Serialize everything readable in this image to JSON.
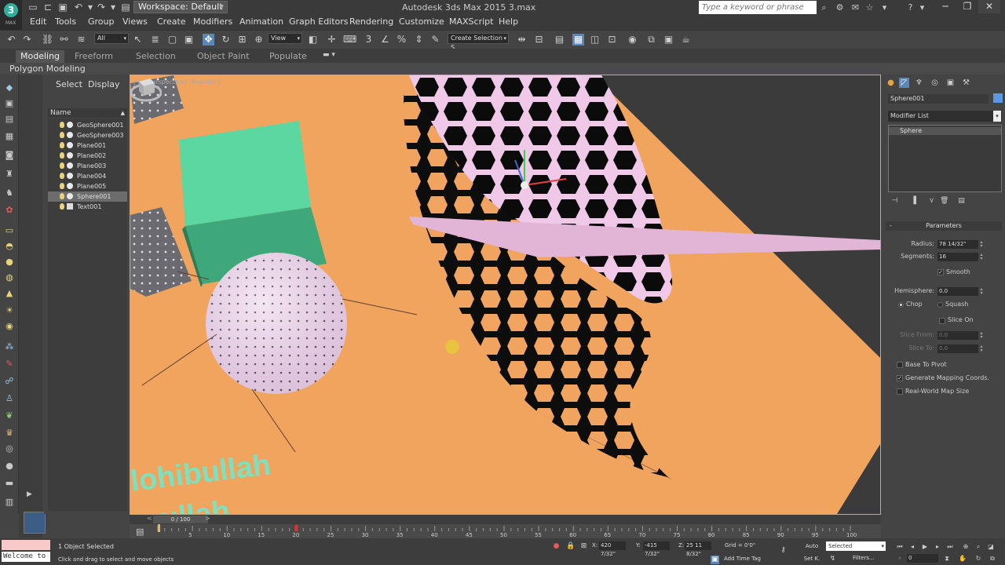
{
  "app": {
    "logo_letter": "3",
    "logo_sub": "MAX",
    "title": "Autodesk 3ds Max  2015      3.max",
    "workspace": "Workspace: Default",
    "search_placeholder": "Type a keyword or phrase"
  },
  "menu": [
    "Edit",
    "Tools",
    "Group",
    "Views",
    "Create",
    "Modifiers",
    "Animation",
    "Graph Editors",
    "Rendering",
    "Customize",
    "MAXScript",
    "Help"
  ],
  "toolbar": {
    "selection_filter": "All",
    "ref_coord": "View",
    "named_selection": "Create Selection S"
  },
  "ribbon": {
    "tabs": [
      "Modeling",
      "Freeform",
      "Selection",
      "Object Paint",
      "Populate"
    ],
    "active_tab": "Modeling",
    "panel_label": "Polygon Modeling"
  },
  "explorer": {
    "tabs": [
      "Select",
      "Display"
    ],
    "column_header": "Name",
    "items": [
      {
        "name": "GeoSphere001",
        "selected": false,
        "type": "geo"
      },
      {
        "name": "GeoSphere003",
        "selected": false,
        "type": "geo"
      },
      {
        "name": "Plane001",
        "selected": false,
        "type": "geo"
      },
      {
        "name": "Plane002",
        "selected": false,
        "type": "geo"
      },
      {
        "name": "Plane003",
        "selected": false,
        "type": "geo"
      },
      {
        "name": "Plane004",
        "selected": false,
        "type": "geo"
      },
      {
        "name": "Plane005",
        "selected": false,
        "type": "geo"
      },
      {
        "name": "Sphere001",
        "selected": true,
        "type": "geo"
      },
      {
        "name": "Text001",
        "selected": false,
        "type": "text"
      }
    ]
  },
  "viewport": {
    "label": "[+] [Perspective] [Realistic]",
    "text_line1": "lohibullah",
    "text_line2": "ullah"
  },
  "command_panel": {
    "object_name": "Sphere001",
    "object_color": "#5b98e4",
    "modifier_list": "Modifier List",
    "stack_item": "Sphere",
    "rollout_title": "Parameters",
    "radius_label": "Radius:",
    "radius_value": "78 14/32\"",
    "segments_label": "Segments:",
    "segments_value": "16",
    "smooth_label": "Smooth",
    "hemisphere_label": "Hemisphere:",
    "hemisphere_value": "0.0",
    "chop_label": "Chop",
    "squash_label": "Squash",
    "slice_on_label": "Slice On",
    "slice_from_label": "Slice From:",
    "slice_from_value": "0.0",
    "slice_to_label": "Slice To:",
    "slice_to_value": "0.0",
    "base_to_pivot_label": "Base To Pivot",
    "gen_mapping_label": "Generate Mapping Coords.",
    "real_world_label": "Real-World Map Size"
  },
  "timeline": {
    "slider": "0 / 100",
    "ticks": [
      "5",
      "10",
      "15",
      "20",
      "25",
      "30",
      "35",
      "40",
      "45",
      "50",
      "55",
      "60",
      "65",
      "70",
      "75",
      "80",
      "85",
      "90",
      "95",
      "100"
    ]
  },
  "status": {
    "maxscript": "Welcome to",
    "selected_count": "1 Object Selected",
    "prompt": "Click and drag to select and move objects",
    "x_label": "X:",
    "x_value": "420 7/32\"",
    "y_label": "Y:",
    "y_value": "-415 7/32\"",
    "z_label": "Z:",
    "z_value": "25 11 8/32\"",
    "grid": "Grid = 0'0\"",
    "auto": "Auto",
    "set_key": "Set K.",
    "key_filter": "Selected",
    "filters": "Filters...",
    "add_time_tag": "Add Time Tag",
    "frame": "0"
  }
}
